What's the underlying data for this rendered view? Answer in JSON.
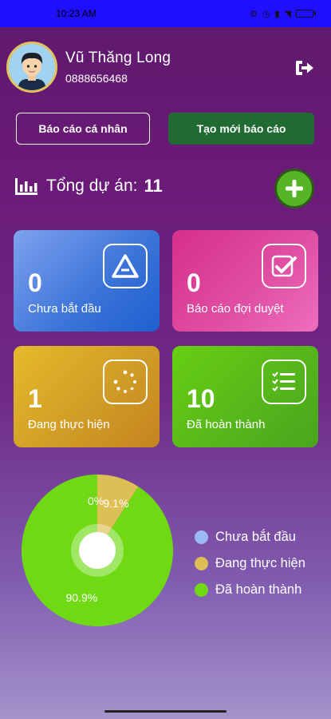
{
  "status_bar": {
    "time": "10:23 AM"
  },
  "profile": {
    "name": "Vũ Thăng Long",
    "phone": "0888656468"
  },
  "buttons": {
    "personal_report": "Báo cáo cá nhân",
    "create_report": "Tạo mới báo cáo"
  },
  "summary": {
    "total_label": "Tổng dự án:",
    "total_value": "11"
  },
  "cards": [
    {
      "value": "0",
      "label": "Chưa bắt đầu",
      "icon": "a-logo-icon"
    },
    {
      "value": "0",
      "label": "Báo cáo đợi duyệt",
      "icon": "check-double-icon"
    },
    {
      "value": "1",
      "label": "Đang thực hiện",
      "icon": "loading-dots-icon"
    },
    {
      "value": "10",
      "label": "Đã hoàn thành",
      "icon": "checklist-icon"
    }
  ],
  "chart_data": {
    "type": "pie",
    "slices": [
      {
        "label": "Chưa bắt đầu",
        "value": 0,
        "display": "0%",
        "color": "#9db9f5"
      },
      {
        "label": "Đang thực hiện",
        "value": 9.1,
        "display": "9.1%",
        "color": "#dcbf55"
      },
      {
        "label": "Đã hoàn thành",
        "value": 90.9,
        "display": "90.9%",
        "color": "#6fda14"
      }
    ],
    "legend_position": "right"
  },
  "colors": {
    "status_bar": "#1f0fff",
    "create_button": "#1f6b32",
    "add_button": "#55b526"
  }
}
